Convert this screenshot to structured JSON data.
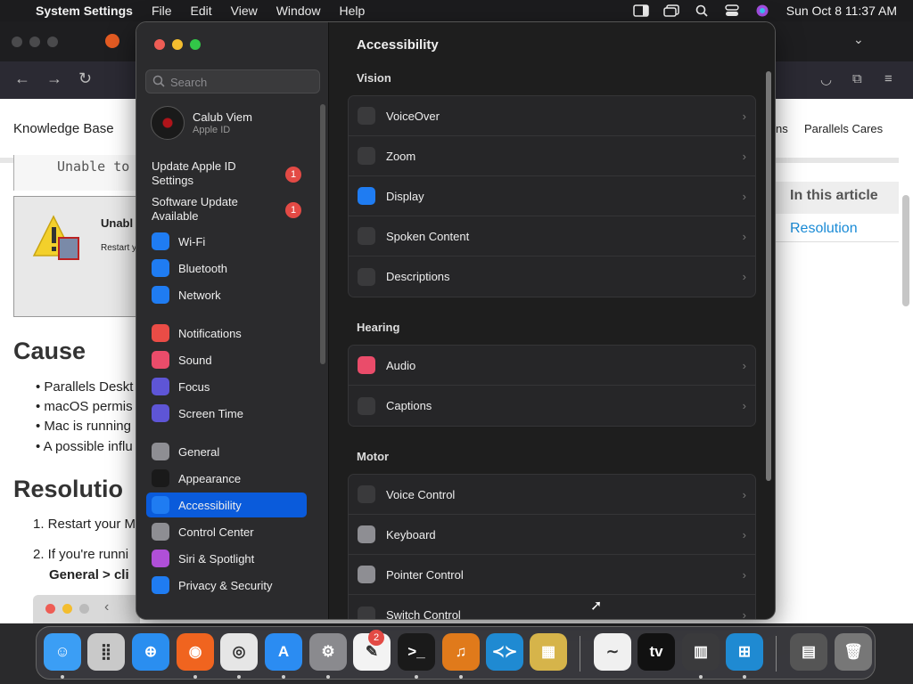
{
  "menubar": {
    "app": "System Settings",
    "menus": [
      "File",
      "Edit",
      "View",
      "Window",
      "Help"
    ],
    "clock": "Sun Oct 8  11:37 AM"
  },
  "browser": {
    "site_title": "Knowledge Base",
    "nav_partial": "ns",
    "nav_link": "Parallels Cares",
    "code_text": "Unable to",
    "warn_title": "Unabl",
    "warn_sub": "Restart y",
    "cause_heading": "Cause",
    "cause_bullets": [
      "Parallels Deskt",
      "macOS permis",
      "Mac is running",
      "A possible influ"
    ],
    "resolution_heading": "Resolutio",
    "steps": [
      "1. Restart your M",
      "2. If you're runni"
    ],
    "step2_cont": "General > cli",
    "toc_heading": "In this article",
    "toc_link": "Resolution"
  },
  "settings": {
    "search_placeholder": "Search",
    "user_name": "Calub Viem",
    "user_sub": "Apple ID",
    "notices": [
      {
        "label": "Update Apple ID Settings",
        "badge": "1"
      },
      {
        "label": "Software Update Available",
        "badge": "1"
      }
    ],
    "sidebar": [
      {
        "label": "Wi-Fi",
        "icon": "wifi-icon",
        "color": "#1f7cf2"
      },
      {
        "label": "Bluetooth",
        "icon": "bluetooth-icon",
        "color": "#1f7cf2"
      },
      {
        "label": "Network",
        "icon": "globe-icon",
        "color": "#1f7cf2"
      },
      {
        "label": "Notifications",
        "icon": "bell-icon",
        "color": "#ea4c46"
      },
      {
        "label": "Sound",
        "icon": "speaker-icon",
        "color": "#ea4c6a"
      },
      {
        "label": "Focus",
        "icon": "moon-icon",
        "color": "#5e55d6"
      },
      {
        "label": "Screen Time",
        "icon": "hourglass-icon",
        "color": "#5e55d6"
      },
      {
        "label": "General",
        "icon": "gear-icon",
        "color": "#8e8e93"
      },
      {
        "label": "Appearance",
        "icon": "appearance-icon",
        "color": "#1a1a1a"
      },
      {
        "label": "Accessibility",
        "icon": "accessibility-icon",
        "color": "#1f7cf2"
      },
      {
        "label": "Control Center",
        "icon": "control-center-icon",
        "color": "#8e8e93"
      },
      {
        "label": "Siri & Spotlight",
        "icon": "siri-icon",
        "color": "#b04fd8"
      },
      {
        "label": "Privacy & Security",
        "icon": "hand-icon",
        "color": "#1f7cf2"
      }
    ],
    "active": "Accessibility",
    "page_title": "Accessibility",
    "sections": [
      {
        "title": "Vision",
        "rows": [
          {
            "label": "VoiceOver",
            "icon": "voiceover-icon",
            "color": "#3a3a3c"
          },
          {
            "label": "Zoom",
            "icon": "zoom-icon",
            "color": "#3a3a3c"
          },
          {
            "label": "Display",
            "icon": "display-icon",
            "color": "#1f7cf2"
          },
          {
            "label": "Spoken Content",
            "icon": "speech-bubble-icon",
            "color": "#3a3a3c"
          },
          {
            "label": "Descriptions",
            "icon": "descriptions-icon",
            "color": "#3a3a3c"
          }
        ]
      },
      {
        "title": "Hearing",
        "rows": [
          {
            "label": "Audio",
            "icon": "audio-icon",
            "color": "#ea4c6a"
          },
          {
            "label": "Captions",
            "icon": "captions-icon",
            "color": "#3a3a3c"
          }
        ]
      },
      {
        "title": "Motor",
        "rows": [
          {
            "label": "Voice Control",
            "icon": "voice-control-icon",
            "color": "#3a3a3c"
          },
          {
            "label": "Keyboard",
            "icon": "keyboard-icon",
            "color": "#8e8e93"
          },
          {
            "label": "Pointer Control",
            "icon": "pointer-icon",
            "color": "#8e8e93"
          },
          {
            "label": "Switch Control",
            "icon": "switch-control-icon",
            "color": "#3a3a3c"
          }
        ]
      }
    ]
  },
  "dock": {
    "settings_badge": "2",
    "apps": [
      {
        "name": "finder",
        "glyph": "☺",
        "color": "#3b9ef5"
      },
      {
        "name": "launchpad",
        "glyph": "⣿",
        "color": "#c9c9c9"
      },
      {
        "name": "safari",
        "glyph": "⊕",
        "color": "#2a8ef0"
      },
      {
        "name": "firefox",
        "glyph": "◉",
        "color": "#f0641f"
      },
      {
        "name": "chrome",
        "glyph": "◎",
        "color": "#e6e6e6"
      },
      {
        "name": "app-store",
        "glyph": "A",
        "color": "#2b8cf2"
      },
      {
        "name": "system-settings",
        "glyph": "⚙",
        "color": "#8a8a8e"
      },
      {
        "name": "textedit",
        "glyph": "✎",
        "color": "#f3f3f3"
      },
      {
        "name": "terminal",
        "glyph": ">_",
        "color": "#1a1a1a"
      },
      {
        "name": "garageband",
        "glyph": "♫",
        "color": "#e07a1b"
      },
      {
        "name": "vscode",
        "glyph": "≺≻",
        "color": "#1f8ad2"
      },
      {
        "name": "archive-utility",
        "glyph": "▦",
        "color": "#d6b44a"
      },
      {
        "name": "freeform",
        "glyph": "∼",
        "color": "#f0f0f0"
      },
      {
        "name": "apple-tv",
        "glyph": "tv",
        "color": "#111"
      },
      {
        "name": "parallels",
        "glyph": "▥",
        "color": "#3a3a3c"
      },
      {
        "name": "windows",
        "glyph": "⊞",
        "color": "#1f8ad2"
      },
      {
        "name": "downloads",
        "glyph": "▤",
        "color": "#555"
      },
      {
        "name": "trash",
        "glyph": "🗑",
        "color": "#777"
      }
    ]
  }
}
